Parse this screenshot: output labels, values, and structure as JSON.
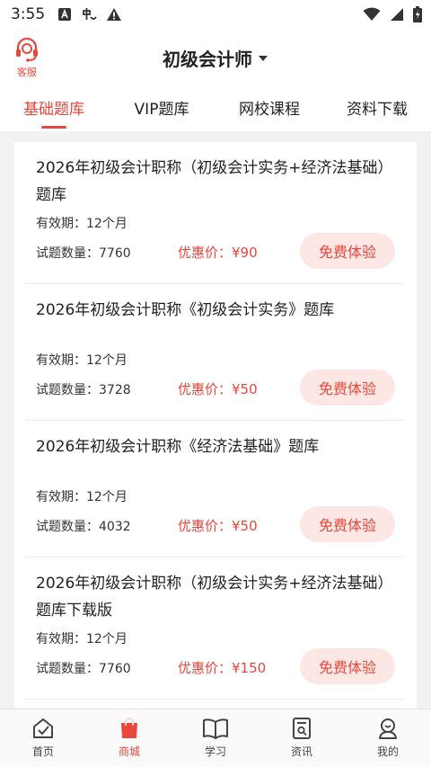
{
  "status_bar": {
    "time": "3:55"
  },
  "header": {
    "service_label": "客服",
    "title": "初级会计师"
  },
  "tabs": [
    {
      "label": "基础题库",
      "active": true
    },
    {
      "label": "VIP题库",
      "active": false
    },
    {
      "label": "网校课程",
      "active": false
    },
    {
      "label": "资料下载",
      "active": false
    }
  ],
  "products": [
    {
      "name": "2026年初级会计职称（初级会计实务+经济法基础）题库",
      "validity": "有效期：12个月",
      "count": "试题数量：7760",
      "price": "优惠价：¥90",
      "trial_label": "免费体验"
    },
    {
      "name": "2026年初级会计职称《初级会计实务》题库",
      "validity": "有效期：12个月",
      "count": "试题数量：3728",
      "price": "优惠价：¥50",
      "trial_label": "免费体验"
    },
    {
      "name": "2026年初级会计职称《经济法基础》题库",
      "validity": "有效期：12个月",
      "count": "试题数量：4032",
      "price": "优惠价：¥50",
      "trial_label": "免费体验"
    },
    {
      "name": "2026年初级会计职称（初级会计实务+经济法基础）题库下载版",
      "validity": "有效期：12个月",
      "count": "试题数量：7760",
      "price": "优惠价：¥150",
      "trial_label": "免费体验"
    }
  ],
  "bottom_nav": [
    {
      "label": "首页",
      "icon": "home-icon",
      "active": false
    },
    {
      "label": "商城",
      "icon": "shopping-bag-icon",
      "active": true
    },
    {
      "label": "学习",
      "icon": "book-icon",
      "active": false
    },
    {
      "label": "资讯",
      "icon": "news-icon",
      "active": false
    },
    {
      "label": "我的",
      "icon": "profile-icon",
      "active": false
    }
  ],
  "colors": {
    "accent": "#e8473c",
    "trial_bg": "#fde7e4",
    "page_bg": "#f2f2f2"
  }
}
